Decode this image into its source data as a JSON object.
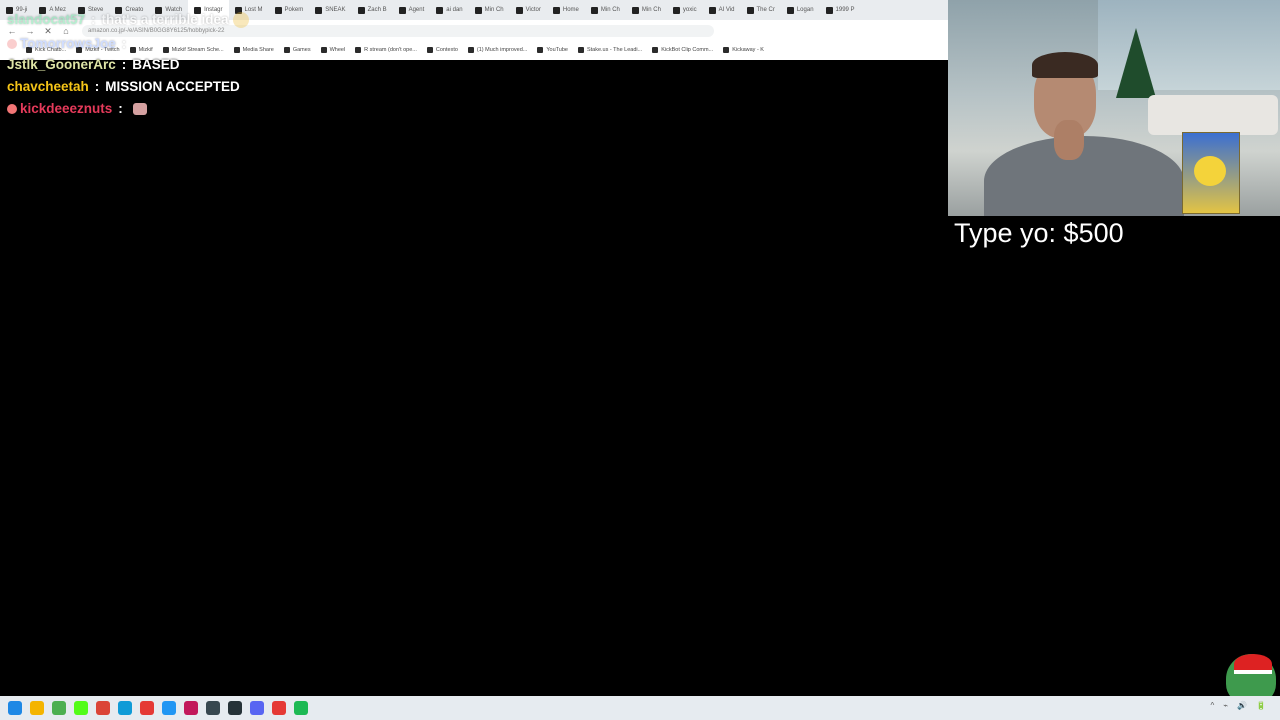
{
  "browser": {
    "tabs": [
      "99-ji",
      "A Mez",
      "Steve",
      "Creato",
      "Watch",
      "Instagr",
      "Lost M",
      "Pokem",
      "SNEAK",
      "Zach B",
      "Agent",
      "ai dan",
      "Min Ch",
      "Victor",
      "Home",
      "Min Ch",
      "Min Ch",
      "yoxic",
      "AI Vid",
      "The Cr",
      "Logan",
      "1999 P"
    ],
    "url": "amazon.co.jp/-/e/ASIN/B0GG8Y6125/hobbypick-22",
    "bookmarks": [
      "Kick Chatb...",
      "Mizkif - Twitch",
      "Mizkif",
      "Mizkif Stream Sche...",
      "Media Share",
      "Games",
      "Wheel",
      "R stream (don't ope...",
      "Contexto",
      "(1) Much improved...",
      "YouTube",
      "Stake.us - The Leadi...",
      "KickBot Clip Comm...",
      "Kickaway - K"
    ]
  },
  "chat": [
    {
      "user": "slandocat57",
      "user_color": "#2fd27a",
      "message": "that's a terrible idea",
      "faded": true,
      "emote": "face"
    },
    {
      "user": "TomorrowsJoe",
      "user_color": "#7aa0ff",
      "message": "",
      "faded": true,
      "emote": "badge"
    },
    {
      "user": "Jstlk_GoonerArc",
      "user_color": "#dfe5a6",
      "message": "BASED",
      "faded": false,
      "emote": ""
    },
    {
      "user": "chavcheetah",
      "user_color": "#f5c518",
      "message": "MISSION ACCEPTED",
      "faded": false,
      "emote": ""
    },
    {
      "user": "kickdeeeznuts",
      "user_color": "#e53a5a",
      "message": "",
      "faded": false,
      "emote": "sticker"
    }
  ],
  "overlay": {
    "donation_text": "Type yo: $500"
  },
  "taskbar": {
    "icons": [
      {
        "name": "windows-start-icon",
        "color": "#1e88e5"
      },
      {
        "name": "file-explorer-icon",
        "color": "#f4b400"
      },
      {
        "name": "app-icon",
        "color": "#4caf50"
      },
      {
        "name": "kick-icon",
        "color": "#53fc18"
      },
      {
        "name": "chrome-icon",
        "color": "#db4437"
      },
      {
        "name": "edge-icon",
        "color": "#0f9bd7"
      },
      {
        "name": "red-app-icon",
        "color": "#e53935"
      },
      {
        "name": "app-icon",
        "color": "#2196f3"
      },
      {
        "name": "app-icon",
        "color": "#c2185b"
      },
      {
        "name": "obs-icon",
        "color": "#37474f"
      },
      {
        "name": "app-icon",
        "color": "#263238"
      },
      {
        "name": "discord-icon",
        "color": "#5865f2"
      },
      {
        "name": "app-icon",
        "color": "#e53935"
      },
      {
        "name": "spotify-icon",
        "color": "#1db954"
      }
    ],
    "tray": [
      "^",
      "⌁",
      "🔊",
      "🔋"
    ]
  }
}
